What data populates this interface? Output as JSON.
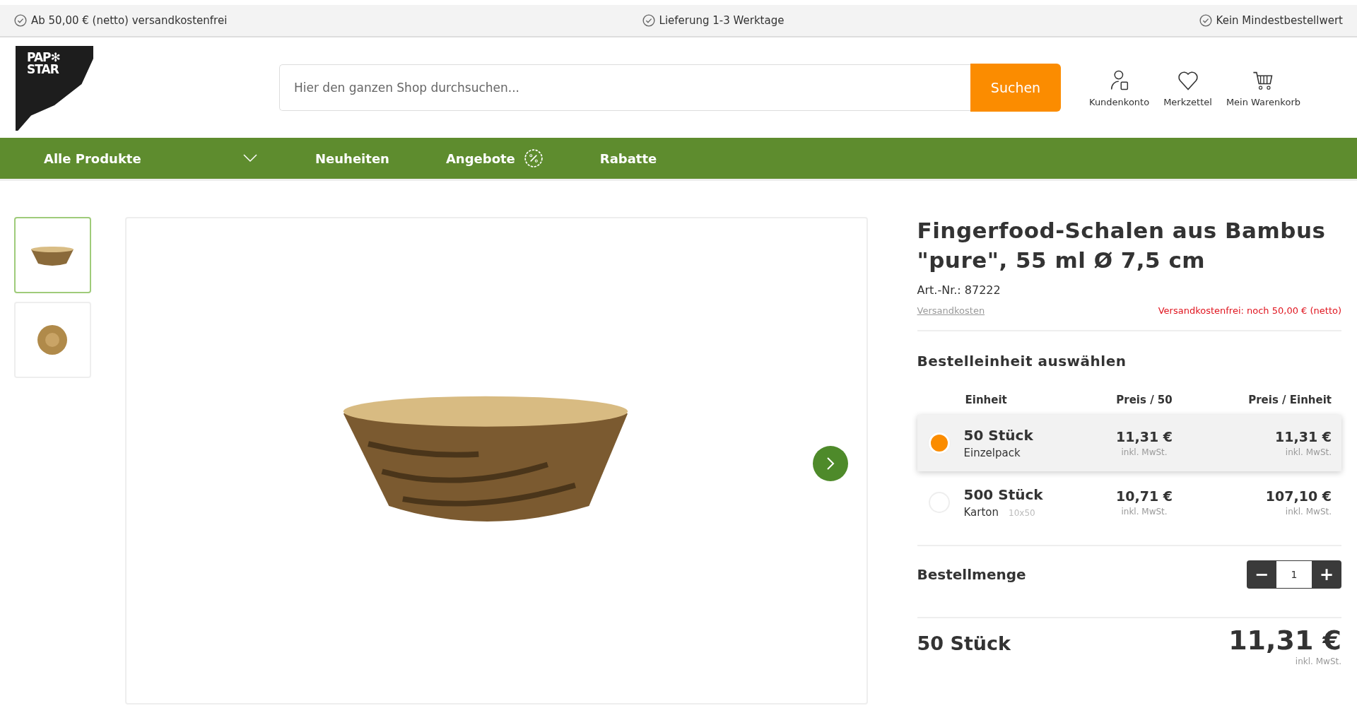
{
  "top_bar": [
    {
      "text": "Ab 50,00 € (netto) versandkostenfrei"
    },
    {
      "text": "Lieferung 1-3 Werktage"
    },
    {
      "text": "Kein Mindestbestellwert"
    }
  ],
  "logo": {
    "line1": "PAP✻",
    "line2": "STAR"
  },
  "search": {
    "placeholder": "Hier den ganzen Shop durchsuchen...",
    "button": "Suchen"
  },
  "header_actions": [
    {
      "kind": "account",
      "label": "Kundenkonto"
    },
    {
      "kind": "wishlist",
      "label": "Merkzettel"
    },
    {
      "kind": "cart",
      "label": "Mein Warenkorb"
    }
  ],
  "nav": [
    {
      "label": "Alle Produkte",
      "kind": "dropdown"
    },
    {
      "label": "Neuheiten",
      "kind": "plain"
    },
    {
      "label": "Angebote",
      "kind": "percent"
    },
    {
      "label": "Rabatte",
      "kind": "plain"
    }
  ],
  "thumbnails": [
    {
      "kind": "side",
      "selected": true
    },
    {
      "kind": "top",
      "selected": false
    }
  ],
  "product": {
    "title": "Fingerfood-Schalen aus Bambus \"pure\", 55 ml Ø 7,5 cm",
    "article": "Art.-Nr.: 87222",
    "shipping_link": "Versandkosten",
    "free_shipping": "Versandkostenfrei: noch 50,00 € (netto)"
  },
  "unit_section": {
    "heading": "Bestelleinheit auswählen",
    "columns": [
      "Einheit",
      "Preis / 50",
      "Preis / Einheit"
    ],
    "options": [
      {
        "name": "50 Stück",
        "pack": "Einzelpack",
        "price": "11,31 €",
        "price_note": "inkl. MwSt.",
        "unit_price": "11,31 €",
        "unit_note": "inkl. MwSt.",
        "selected": true
      },
      {
        "name": "500 Stück",
        "pack": "Karton",
        "pack_note": "10x50",
        "price": "10,71 €",
        "price_note": "inkl. MwSt.",
        "unit_price": "107,10 €",
        "unit_note": "inkl. MwSt.",
        "selected": false
      }
    ]
  },
  "quantity": {
    "label": "Bestellmenge",
    "minus": "−",
    "value": "1",
    "plus": "+"
  },
  "total": {
    "label": "50 Stück",
    "price": "11,31 €",
    "note": "inkl. MwSt."
  }
}
